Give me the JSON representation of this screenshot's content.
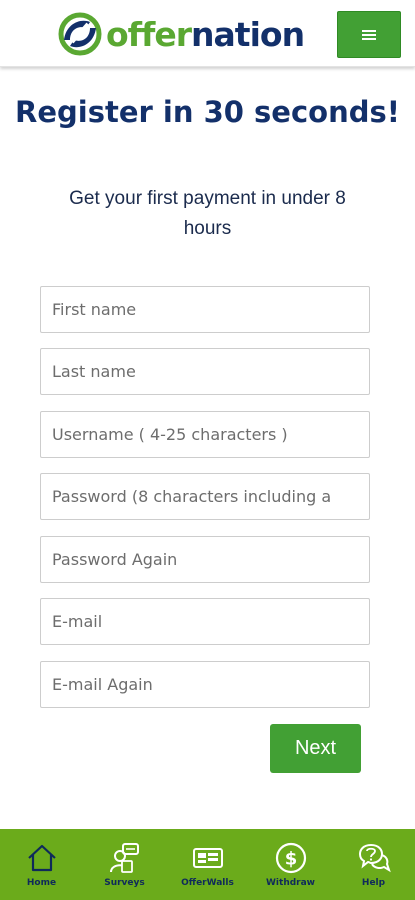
{
  "header": {
    "logo_offer": "offer",
    "logo_nation": "nation",
    "menu_icon": "hamburger-icon"
  },
  "main": {
    "title": "Register in 30 seconds!",
    "subtitle": "Get your first payment in under 8 hours",
    "fields": {
      "first_name": {
        "placeholder": "First name",
        "value": ""
      },
      "last_name": {
        "placeholder": "Last name",
        "value": ""
      },
      "username": {
        "placeholder": "Username ( 4-25 characters )",
        "value": ""
      },
      "password": {
        "placeholder": "Password (8 characters including a",
        "value": ""
      },
      "password_again": {
        "placeholder": "Password Again",
        "value": ""
      },
      "email": {
        "placeholder": "E-mail",
        "value": ""
      },
      "email_again": {
        "placeholder": "E-mail Again",
        "value": ""
      }
    },
    "next_label": "Next"
  },
  "bottom_nav": {
    "items": [
      {
        "label": "Home",
        "icon": "home-icon"
      },
      {
        "label": "Surveys",
        "icon": "surveys-icon"
      },
      {
        "label": "OfferWalls",
        "icon": "offerwalls-icon"
      },
      {
        "label": "Withdraw",
        "icon": "dollar-icon"
      },
      {
        "label": "Help",
        "icon": "help-icon"
      }
    ]
  },
  "colors": {
    "brand_green": "#42a034",
    "brand_navy": "#13306a",
    "nav_green": "#6bab1b"
  }
}
